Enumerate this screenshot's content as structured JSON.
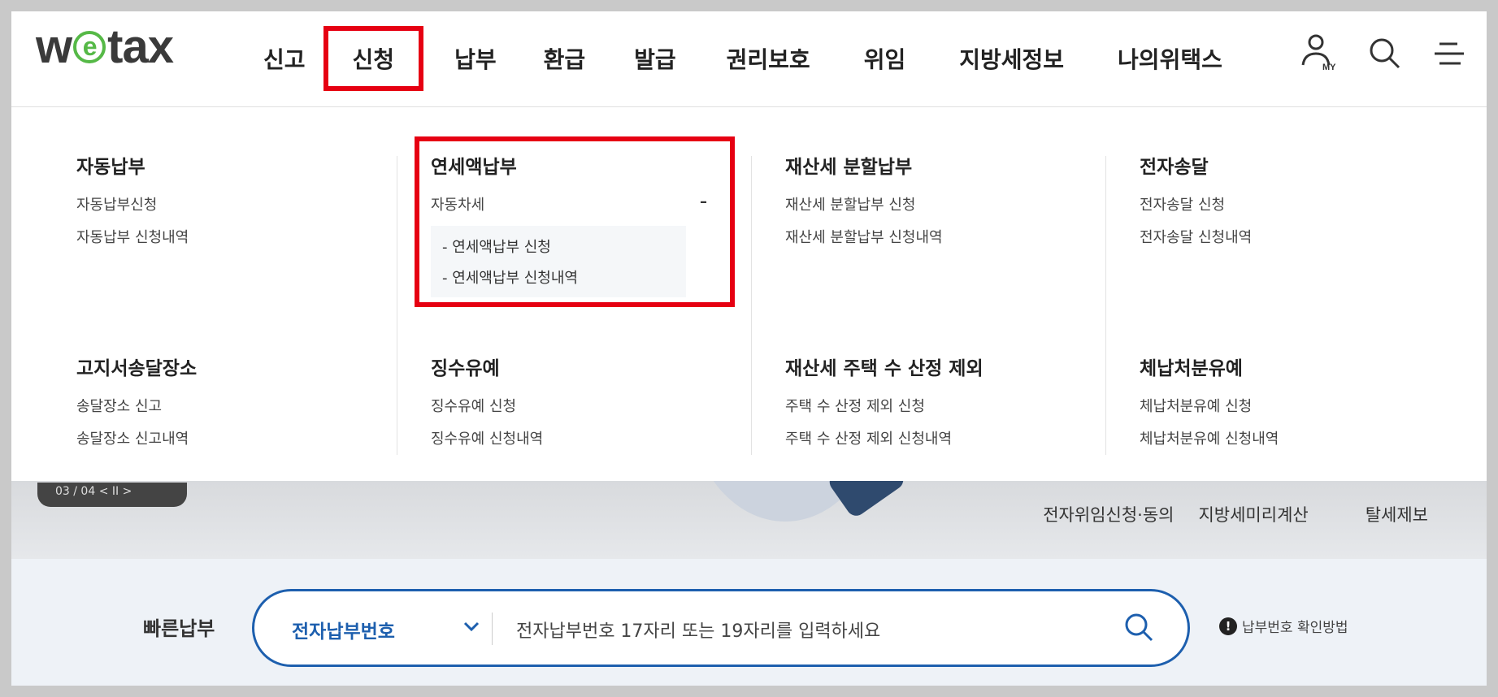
{
  "header": {
    "logo": {
      "pre": "w",
      "mark": "e",
      "post": "tax"
    },
    "nav": [
      "신고",
      "신청",
      "납부",
      "환급",
      "발급",
      "권리보호",
      "위임",
      "지방세정보",
      "나의위택스"
    ],
    "active_nav": "신청",
    "icons": [
      "my-user-icon",
      "search-icon",
      "menu-icon"
    ],
    "my_label": "MY"
  },
  "mega_menu": {
    "columns": [
      [
        {
          "title": "자동납부",
          "items": [
            "자동납부신청",
            "자동납부 신청내역"
          ]
        },
        {
          "title": "고지서송달장소",
          "items": [
            "송달장소 신고",
            "송달장소 신고내역"
          ]
        }
      ],
      [
        {
          "title": "연세액납부",
          "expanded": {
            "label": "자동차세",
            "toggle": "–",
            "children": [
              "- 연세액납부 신청",
              "- 연세액납부 신청내역"
            ]
          }
        },
        {
          "title": "징수유예",
          "items": [
            "징수유예 신청",
            "징수유예 신청내역"
          ]
        }
      ],
      [
        {
          "title": "재산세 분할납부",
          "items": [
            "재산세 분할납부 신청",
            "재산세 분할납부 신청내역"
          ]
        },
        {
          "title": "재산세 주택 수 산정 제외",
          "items": [
            "주택 수 산정 제외 신청",
            "주택 수 산정 제외 신청내역"
          ]
        }
      ],
      [
        {
          "title": "전자송달",
          "items": [
            "전자송달 신청",
            "전자송달 신청내역"
          ]
        },
        {
          "title": "체납처분유예",
          "items": [
            "체납처분유예 신청",
            "체납처분유예 신청내역"
          ]
        }
      ]
    ]
  },
  "hero": {
    "pager": "03 / 04  <  II  >",
    "quick_links": [
      "전자위임신청·동의",
      "지방세미리계산",
      "탈세제보"
    ]
  },
  "fastpay": {
    "label": "빠른납부",
    "select_value": "전자납부번호",
    "placeholder": "전자납부번호 17자리 또는 19자리를 입력하세요",
    "help_text": "납부번호 확인방법",
    "help_mark": "!"
  },
  "colors": {
    "accent": "#1d5fae",
    "highlight": "#e60012",
    "logo_green": "#56b947"
  }
}
